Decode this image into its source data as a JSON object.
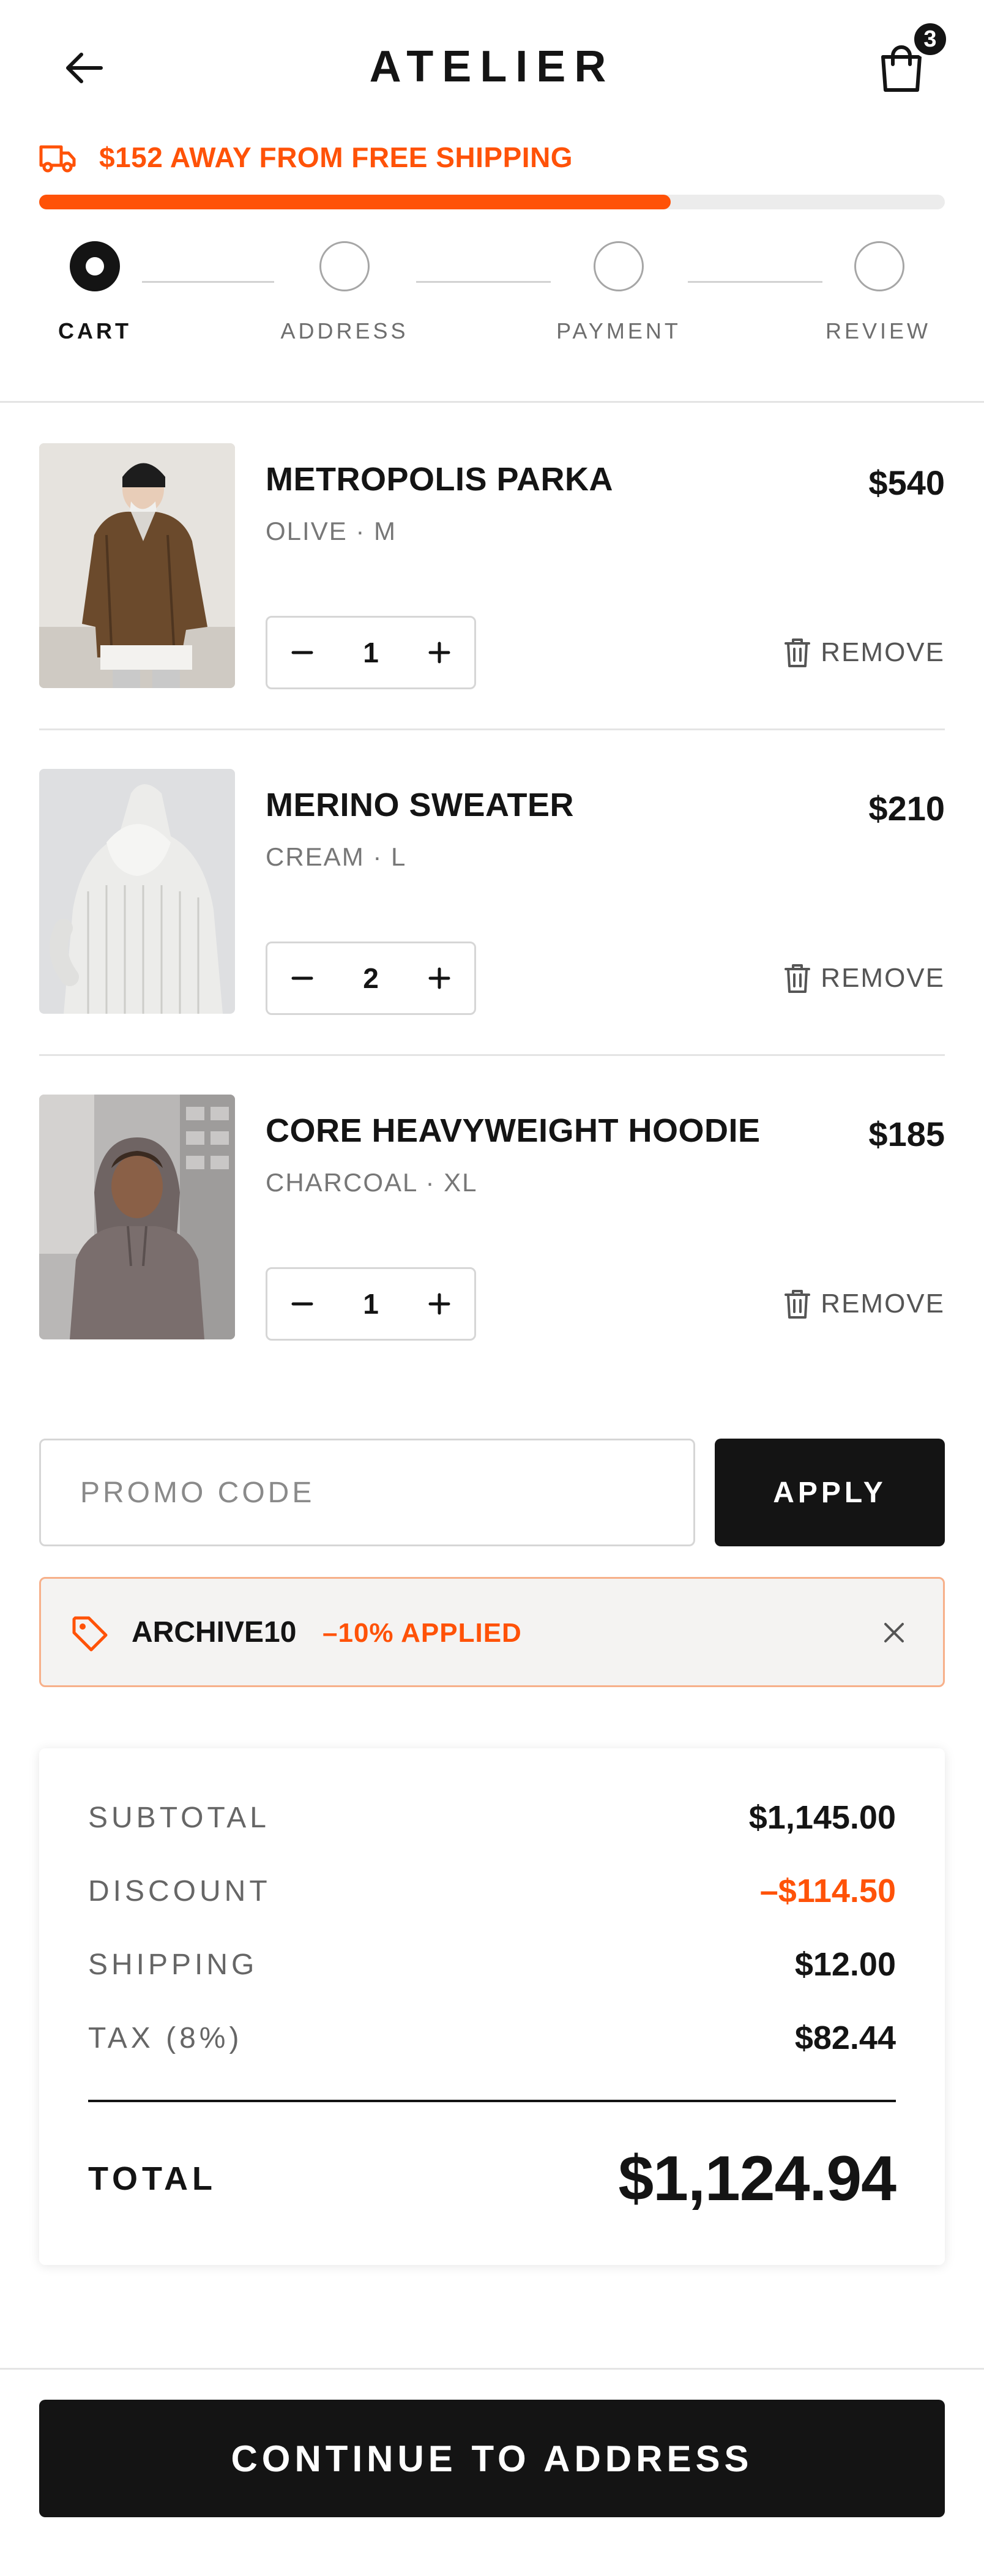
{
  "header": {
    "brand": "ATELIER",
    "back_icon": "arrow-left-icon",
    "cart_icon": "shopping-bag-icon",
    "cart_count": "3"
  },
  "shipping": {
    "icon": "truck-icon",
    "message": "$152 AWAY FROM FREE SHIPPING",
    "progress_fraction": 0.697,
    "accent_color": "#ff5208"
  },
  "steps": [
    {
      "label": "CART",
      "state": "active"
    },
    {
      "label": "ADDRESS",
      "state": "pending"
    },
    {
      "label": "PAYMENT",
      "state": "pending"
    },
    {
      "label": "REVIEW",
      "state": "pending"
    }
  ],
  "items": [
    {
      "name": "METROPOLIS PARKA",
      "variant": "OLIVE · M",
      "price": "$540",
      "qty": "1",
      "remove_label": "REMOVE",
      "image": "product-photo-parka"
    },
    {
      "name": "MERINO SWEATER",
      "variant": "CREAM · L",
      "price": "$210",
      "qty": "2",
      "remove_label": "REMOVE",
      "image": "product-photo-sweater"
    },
    {
      "name": "CORE HEAVYWEIGHT HOODIE",
      "variant": "CHARCOAL · XL",
      "price": "$185",
      "qty": "1",
      "remove_label": "REMOVE",
      "image": "product-photo-hoodie"
    }
  ],
  "promo": {
    "placeholder": "PROMO CODE",
    "value": "",
    "apply_label": "APPLY",
    "applied_code": "ARCHIVE10",
    "applied_note": "–10% APPLIED",
    "tag_icon": "tag-icon",
    "close_icon": "close-icon"
  },
  "summary": {
    "rows": [
      {
        "label": "SUBTOTAL",
        "value": "$1,145.00"
      },
      {
        "label": "DISCOUNT",
        "value": "–$114.50"
      },
      {
        "label": "SHIPPING",
        "value": "$12.00"
      },
      {
        "label": "TAX (8%)",
        "value": "$82.44"
      }
    ],
    "total_label": "TOTAL",
    "total_value": "$1,124.94"
  },
  "cta": {
    "label": "CONTINUE TO ADDRESS"
  },
  "colors": {
    "ink": "#141414",
    "accent": "#ff5208",
    "muted": "#777777",
    "coupon_border": "#f7b08a"
  }
}
